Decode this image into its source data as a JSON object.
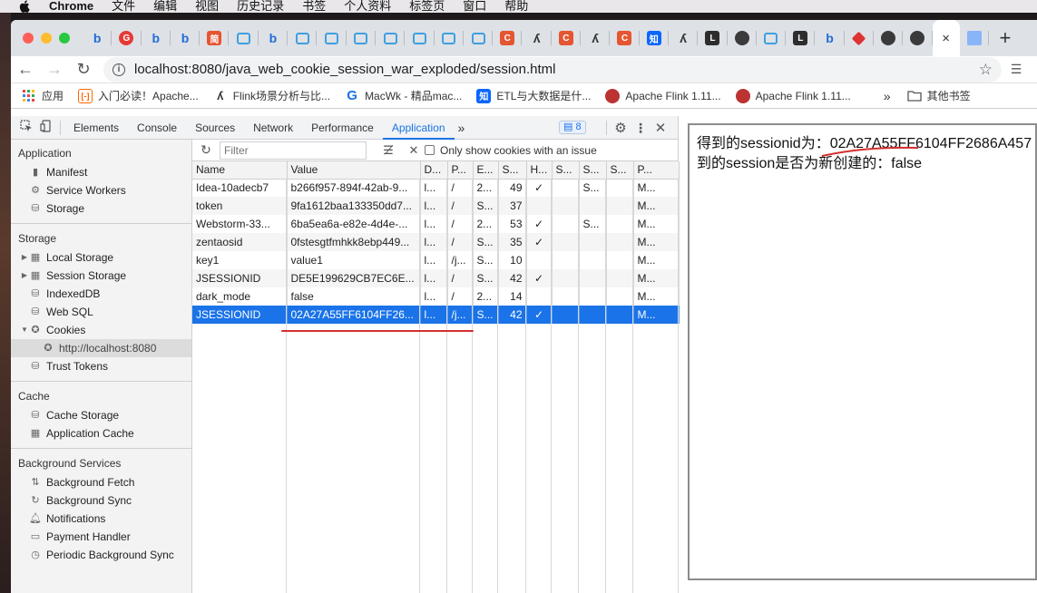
{
  "menubar": {
    "app": "Chrome",
    "items": [
      "文件",
      "编辑",
      "视图",
      "历史记录",
      "书签",
      "个人资料",
      "标签页",
      "窗口",
      "帮助"
    ]
  },
  "tabs": {
    "favicons": [
      "bing",
      "circle-red",
      "bing",
      "bing",
      "red-square",
      "bili",
      "bing",
      "bili",
      "bili",
      "bili",
      "bili",
      "bili",
      "bili",
      "bili",
      "csdn",
      "cms",
      "csdn",
      "cms",
      "csdn",
      "zhihu",
      "cms",
      "dark",
      "globe",
      "bili",
      "dark",
      "bing",
      "cube",
      "globe",
      "globe"
    ],
    "csdn_glyph": "C",
    "zhihu_glyph": "知",
    "jian_glyph": "简",
    "circle_glyph": "G",
    "dark_glyph": "L",
    "new_tab": "+",
    "close": "×"
  },
  "toolbar": {
    "url": "localhost:8080/java_web_cookie_session_war_exploded/session.html"
  },
  "bookmarks": {
    "items": [
      {
        "label": "应用",
        "color": "#e44"
      },
      {
        "label": "入门必读！Apache...",
        "color": "#f60"
      },
      {
        "label": "Flink场景分析与比...",
        "color": "#333"
      },
      {
        "label": "MacWk - 精品mac...",
        "color": "#1a73e8"
      },
      {
        "label": "ETL与大数据是什...",
        "color": "#0a66ff"
      },
      {
        "label": "Apache Flink 1.11...",
        "color": "#b33"
      },
      {
        "label": "Apache Flink 1.11...",
        "color": "#b33"
      }
    ],
    "overflow": "»",
    "other": "其他书签"
  },
  "devtools": {
    "tabs": [
      "Elements",
      "Console",
      "Sources",
      "Network",
      "Performance",
      "Application"
    ],
    "active_tab": "Application",
    "more": "»",
    "badge": "8",
    "sidebar": {
      "application": {
        "header": "Application",
        "items": [
          "Manifest",
          "Service Workers",
          "Storage"
        ]
      },
      "storage": {
        "header": "Storage",
        "items": [
          "Local Storage",
          "Session Storage",
          "IndexedDB",
          "Web SQL",
          "Cookies",
          "http://localhost:8080",
          "Trust Tokens"
        ]
      },
      "cache": {
        "header": "Cache",
        "items": [
          "Cache Storage",
          "Application Cache"
        ]
      },
      "background": {
        "header": "Background Services",
        "items": [
          "Background Fetch",
          "Background Sync",
          "Notifications",
          "Payment Handler",
          "Periodic Background Sync"
        ]
      }
    },
    "filter": {
      "placeholder": "Filter",
      "only_issues_label": "Only show cookies with an issue"
    },
    "table": {
      "headers": [
        "Name",
        "Value",
        "D...",
        "P...",
        "E...",
        "S...",
        "H...",
        "S...",
        "S...",
        "S...",
        "P..."
      ],
      "rows": [
        [
          "Idea-10adecb7",
          "b266f957-894f-42ab-9...",
          "l...",
          "/",
          "2...",
          "49",
          "✓",
          "",
          "S...",
          "",
          "M..."
        ],
        [
          "token",
          "9fa1612baa133350dd7...",
          "l...",
          "/",
          "S...",
          "37",
          "",
          "",
          "",
          "",
          "M..."
        ],
        [
          "Webstorm-33...",
          "6ba5ea6a-e82e-4d4e-...",
          "l...",
          "/",
          "2...",
          "53",
          "✓",
          "",
          "S...",
          "",
          "M..."
        ],
        [
          "zentaosid",
          "0fstesgtfmhkk8ebp449...",
          "l...",
          "/",
          "S...",
          "35",
          "✓",
          "",
          "",
          "",
          "M..."
        ],
        [
          "key1",
          "value1",
          "l...",
          "/j...",
          "S...",
          "10",
          "",
          "",
          "",
          "",
          "M..."
        ],
        [
          "JSESSIONID",
          "DE5E199629CB7EC6E...",
          "l...",
          "/",
          "S...",
          "42",
          "✓",
          "",
          "",
          "",
          "M..."
        ],
        [
          "dark_mode",
          "false",
          "l...",
          "/",
          "2...",
          "14",
          "",
          "",
          "",
          "",
          "M..."
        ],
        [
          "JSESSIONID",
          "02A27A55FF6104FF26...",
          "l...",
          "/j...",
          "S...",
          "42",
          "✓",
          "",
          "",
          "",
          "M..."
        ]
      ],
      "selected_row": 7
    }
  },
  "page": {
    "line1": "得到的sessionid为：02A27A55FF6104FF2686A457",
    "line2": "到的session是否为新创建的：false"
  },
  "colors": {
    "accent": "#1a73e8",
    "annotation": "#d32f2f"
  }
}
